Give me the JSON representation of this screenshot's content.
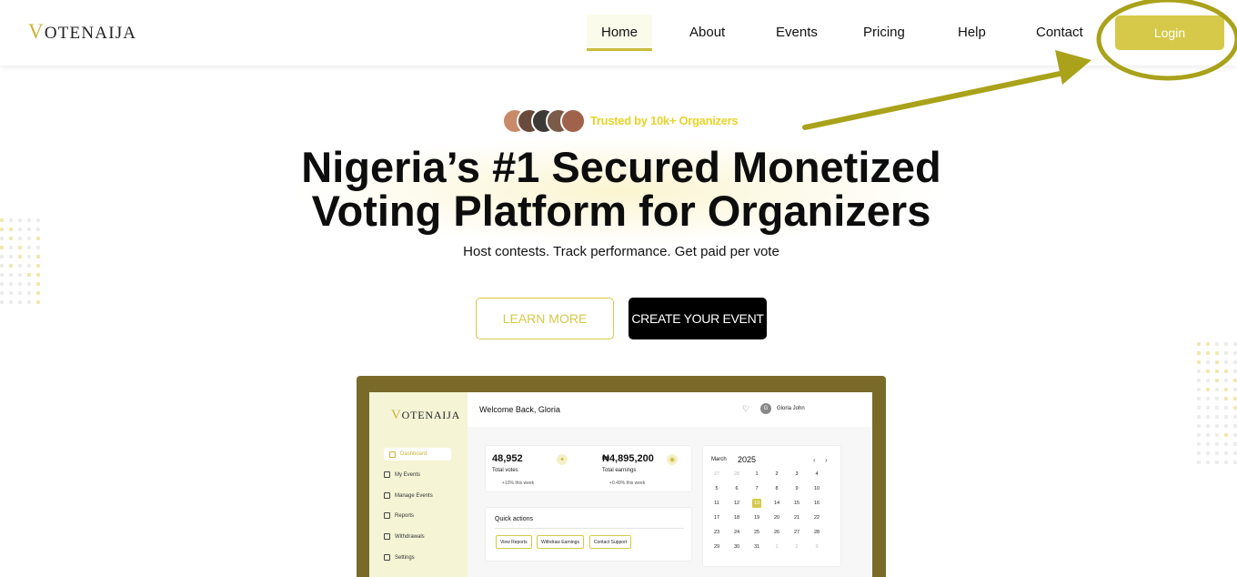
{
  "nav": {
    "brand_v": "V",
    "brand_rest": "OTENAIJA",
    "items": [
      "Home",
      "About",
      "Events",
      "Pricing",
      "Help",
      "Contact"
    ],
    "login": "Login"
  },
  "hero": {
    "trusted": "Trusted by 10k+ Organizers",
    "headline_line1": "Nigeria’s #1 Secured Monetized",
    "headline_line2": "Voting Platform for Organizers",
    "subheadline": "Host contests. Track performance. Get paid per vote",
    "learn_more": "LEARN MORE",
    "create_event": "CREATE YOUR EVENT"
  },
  "dashboard": {
    "brand_v": "V",
    "brand_rest": "OTENAIJA",
    "welcome": "Welcome Back, Gloria",
    "user_initial": "G",
    "user_name": "Gloria John",
    "sidebar": [
      "Dashboard",
      "My Events",
      "Manage Events",
      "Reports",
      "Withdrawals",
      "Settings"
    ],
    "stats": [
      {
        "value": "48,952",
        "label": "Total votes",
        "change": "+10% this week"
      },
      {
        "value": "₦4,895,200",
        "label": "Total earnings",
        "change": "+0.49% this week"
      }
    ],
    "quick_actions": {
      "title": "Quick actions",
      "buttons": [
        "View Reports",
        "Withdraw Earnings",
        "Contact Support"
      ]
    },
    "calendar": {
      "month": "March",
      "year": "2025",
      "prev": "‹",
      "next": "›",
      "rows": [
        [
          "27",
          "28",
          "1",
          "2",
          "3",
          "4"
        ],
        [
          "5",
          "6",
          "7",
          "8",
          "9",
          "10"
        ],
        [
          "11",
          "12",
          "13",
          "14",
          "15",
          "16"
        ],
        [
          "17",
          "18",
          "19",
          "20",
          "21",
          "22"
        ],
        [
          "23",
          "24",
          "25",
          "26",
          "27",
          "28"
        ],
        [
          "29",
          "30",
          "31",
          "1",
          "2",
          "3"
        ]
      ],
      "today": "13"
    }
  },
  "colors": {
    "accent": "#d6c94a",
    "annotation": "#a9a21a",
    "frame": "#7a6a29"
  }
}
